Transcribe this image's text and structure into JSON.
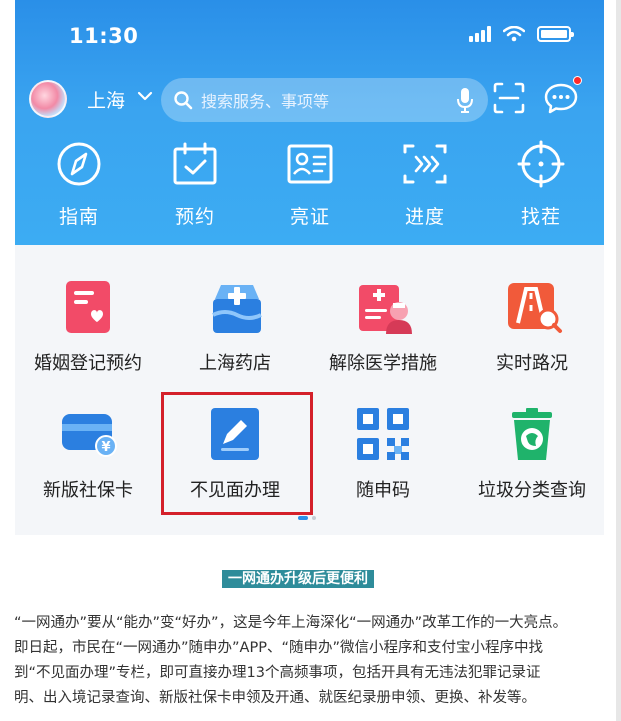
{
  "status": {
    "time": "11:30"
  },
  "header": {
    "city": "上海",
    "search_placeholder": "搜索服务、事项等"
  },
  "quick_actions": [
    {
      "label": "指南",
      "icon": "compass-icon"
    },
    {
      "label": "预约",
      "icon": "calendar-check-icon"
    },
    {
      "label": "亮证",
      "icon": "id-card-icon"
    },
    {
      "label": "进度",
      "icon": "progress-arrows-icon"
    },
    {
      "label": "找茬",
      "icon": "crosshair-icon"
    }
  ],
  "services": [
    {
      "label": "婚姻登记预约",
      "icon": "marriage-booking-icon",
      "color": "#f24b68"
    },
    {
      "label": "上海药店",
      "icon": "pharmacy-icon",
      "color": "#2b7fe0"
    },
    {
      "label": "解除医学措施",
      "icon": "medical-release-icon",
      "color": "#f24b68"
    },
    {
      "label": "实时路况",
      "icon": "traffic-icon",
      "color": "#f15a3a"
    },
    {
      "label": "新版社保卡",
      "icon": "social-security-card-icon",
      "color": "#2b7fe0"
    },
    {
      "label": "不见面办理",
      "icon": "remote-handling-icon",
      "color": "#2b7fe0"
    },
    {
      "label": "随申码",
      "icon": "qr-code-icon",
      "color": "#2b7fe0"
    },
    {
      "label": "垃圾分类查询",
      "icon": "garbage-sorting-icon",
      "color": "#1fb36b"
    }
  ],
  "caption": "一网通办升级后更便利",
  "paragraph_lines": [
    "“一网通办”要从“能办”变“好办”，这是今年上海深化“一网通办”改革工作的一大亮点。",
    "即日起，市民在“一网通办”随申办”APP、“随申办”微信小程序和支付宝小程序中找",
    "到“不见面办理”专栏，即可直接办理13个高频事项，包括开具有无违法犯罪记录证",
    "明、出入境记录查询、新版社保卡申领及开通、就医纪录册申领、更换、补发等。"
  ],
  "colors": {
    "accent": "#2a8fe8",
    "highlight": "#d4202a",
    "caption_bg": "#2e8c9a"
  }
}
